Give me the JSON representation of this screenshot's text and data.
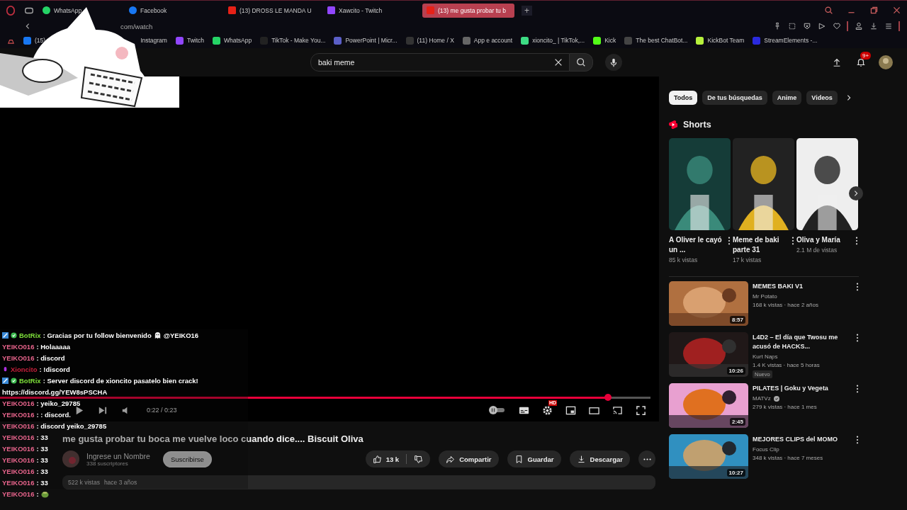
{
  "browser": {
    "tabs": [
      {
        "label": "WhatsApp",
        "selected": false
      },
      {
        "label": "Facebook",
        "selected": false
      },
      {
        "label": "(13) DROSS LE MANDA U",
        "selected": false
      },
      {
        "label": "Xawcito - Twitch",
        "selected": false
      },
      {
        "label": "(13) me gusta probar tu b",
        "selected": true
      }
    ],
    "new_tab": "+",
    "address": "com/watch",
    "bookmarks": [
      {
        "label": "(15)"
      },
      {
        "label": "Instagram"
      },
      {
        "label": "Twitch"
      },
      {
        "label": "WhatsApp"
      },
      {
        "label": "TikTok - Make You..."
      },
      {
        "label": "PowerPoint | Micr..."
      },
      {
        "label": "(11) Home / X"
      },
      {
        "label": "App e account"
      },
      {
        "label": "xioncito_ | TikTok,..."
      },
      {
        "label": "Kick"
      },
      {
        "label": "The best ChatBot..."
      },
      {
        "label": "KickBot Team"
      },
      {
        "label": "StreamElements -..."
      }
    ]
  },
  "youtube": {
    "search": {
      "value": "baki meme"
    },
    "notifications": "9+",
    "player": {
      "level": 0.935,
      "time": "0:22 / 0:23",
      "quality_badge": "HD"
    },
    "video": {
      "title": "me gusta probar tu boca me vuelve loco cuando dice.... Biscuit Oliva",
      "channel": "Ingrese un Nombre",
      "subscribers": "338 suscriptores",
      "subscribe": "Suscribirse",
      "likes": "13 k",
      "actions": [
        {
          "kind": "share",
          "label": "Compartir"
        },
        {
          "kind": "save",
          "label": "Guardar"
        },
        {
          "kind": "download",
          "label": "Descargar"
        }
      ],
      "views": "522 k vistas",
      "age": "hace 3 años"
    },
    "chips": [
      {
        "label": "Todos",
        "selected": true
      },
      {
        "label": "De tus búsquedas",
        "selected": false
      },
      {
        "label": "Anime",
        "selected": false
      },
      {
        "label": "Videos",
        "selected": false
      }
    ],
    "shorts": {
      "title": "Shorts",
      "items": [
        {
          "title": "A Oliver le cayó un ...",
          "views": "85 k vistas"
        },
        {
          "title": "Meme de baki parte 31",
          "views": "17 k vistas"
        },
        {
          "title": "Oliva y María",
          "views": "2.1 M de vistas"
        }
      ]
    },
    "videos": [
      {
        "title": "MEMES BAKI V1",
        "channel": "Mr Potato",
        "meta": "168 k vistas · hace 2 años",
        "duration": "8:57"
      },
      {
        "title": "L4D2 – El día que Twosu me acusó de HACKS...",
        "channel": "Kurt Naps",
        "meta": "1.4 K vistas · hace 5 horas",
        "duration": "10:26",
        "badge": "Nuevo"
      },
      {
        "title": "PILATES | Goku y Vegeta",
        "channel": "MATVz",
        "verified": true,
        "meta": "279 k vistas · hace 1 mes",
        "duration": "2:45"
      },
      {
        "title": "MEJORES CLIPS del MOMO",
        "channel": "Focus Clip",
        "meta": "348 k vistas · hace 7 meses",
        "duration": "10:27"
      }
    ]
  },
  "chat": [
    {
      "kind": "bot",
      "user": "BotRix",
      "color": "#7ee03a",
      "parts": [
        {
          "kind": "text",
          "text": ": Gracias por tu follow bienvenido"
        },
        {
          "kind": "ghost"
        },
        {
          "kind": "text",
          "text": "@YEIKO16"
        }
      ]
    },
    {
      "kind": "viewer",
      "user": "YEIKO016",
      "color": "#e8648c",
      "parts": [
        {
          "kind": "text",
          "text": ": Holaaaaa"
        }
      ]
    },
    {
      "kind": "viewer",
      "user": "YEIKO016",
      "color": "#e8648c",
      "parts": [
        {
          "kind": "text",
          "text": ": discord"
        }
      ]
    },
    {
      "kind": "streamer",
      "user": "Xioncito",
      "color": "#c8203c",
      "parts": [
        {
          "kind": "text",
          "text": ": !discord"
        }
      ]
    },
    {
      "kind": "bot",
      "user": "BotRix",
      "color": "#7ee03a",
      "parts": [
        {
          "kind": "text",
          "text": ": Server discord de xioncito pasatelo bien crack!"
        }
      ]
    },
    {
      "kind": "line",
      "text": "https://discord.gg/YEW8sPSCHA"
    },
    {
      "kind": "viewer",
      "user": "YEIKO016",
      "color": "#e8648c",
      "parts": [
        {
          "kind": "text",
          "text": ": yeiko_29785"
        }
      ]
    },
    {
      "kind": "viewer",
      "user": "YEIKO016",
      "color": "#e8648c",
      "parts": [
        {
          "kind": "text",
          "text": ": : discord."
        }
      ]
    },
    {
      "kind": "viewer",
      "user": "YEIKO016",
      "color": "#e8648c",
      "parts": [
        {
          "kind": "text",
          "text": ": discord yeiko_29785"
        }
      ]
    },
    {
      "kind": "viewer",
      "user": "YEIKO016",
      "color": "#e8648c",
      "parts": [
        {
          "kind": "text",
          "text": ": 33"
        }
      ]
    },
    {
      "kind": "viewer",
      "user": "YEIKO016",
      "color": "#e8648c",
      "parts": [
        {
          "kind": "text",
          "text": ": 33"
        }
      ]
    },
    {
      "kind": "viewer",
      "user": "YEIKO016",
      "color": "#e8648c",
      "parts": [
        {
          "kind": "text",
          "text": ": 33"
        }
      ]
    },
    {
      "kind": "viewer",
      "user": "YEIKO016",
      "color": "#e8648c",
      "parts": [
        {
          "kind": "text",
          "text": ": 33"
        }
      ]
    },
    {
      "kind": "viewer",
      "user": "YEIKO016",
      "color": "#e8648c",
      "parts": [
        {
          "kind": "text",
          "text": ": 33"
        }
      ]
    },
    {
      "kind": "viewer",
      "user": "YEIKO016",
      "color": "#e8648c",
      "parts": [
        {
          "kind": "text",
          "text": ":"
        },
        {
          "kind": "frog"
        }
      ]
    }
  ]
}
